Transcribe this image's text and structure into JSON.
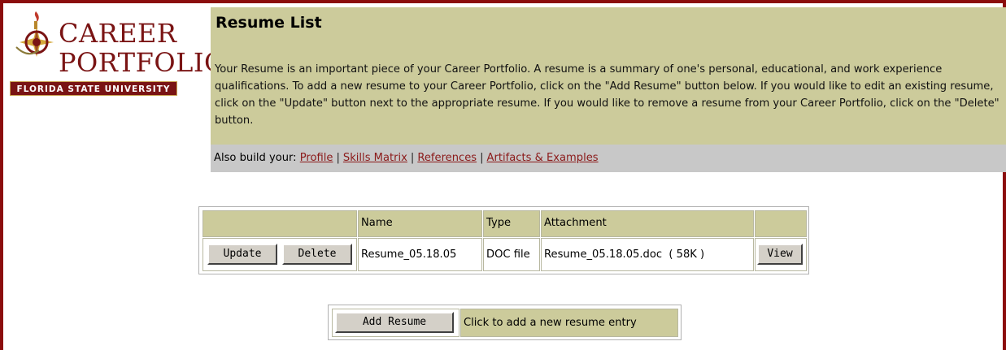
{
  "logo": {
    "word1": "CAREER",
    "word2": "PORTFOLIO",
    "band": "FLORIDA STATE UNIVERSITY"
  },
  "header": {
    "title": "Resume List",
    "intro": "Your Resume is an important piece of your Career Portfolio. A resume is a summary of one's personal, educational, and work experience qualifications. To add a new resume to your Career Portfolio, click on the \"Add Resume\" button below. If you would like to edit an existing resume, click on the \"Update\" button next to the appropriate resume. If you would like to remove a resume from your Career Portfolio, click on the \"Delete\" button."
  },
  "also": {
    "prefix": "Also build your:",
    "links": [
      "Profile",
      "Skills Matrix",
      "References",
      "Artifacts & Examples"
    ],
    "separator": "|"
  },
  "table": {
    "columns": [
      "",
      "Name",
      "Type",
      "Attachment",
      ""
    ],
    "row": {
      "update_label": "Update",
      "delete_label": "Delete",
      "name": "Resume_05.18.05",
      "type": "DOC file",
      "attachment": "Resume_05.18.05.doc  ( 58K )",
      "view_label": "View"
    }
  },
  "add": {
    "button_label": "Add Resume",
    "hint": "Click to add a new resume entry"
  },
  "colors": {
    "frame": "#8b0d0d",
    "panel": "#cccb9b",
    "link": "#8b1a1a",
    "bar": "#c8c8c8"
  }
}
